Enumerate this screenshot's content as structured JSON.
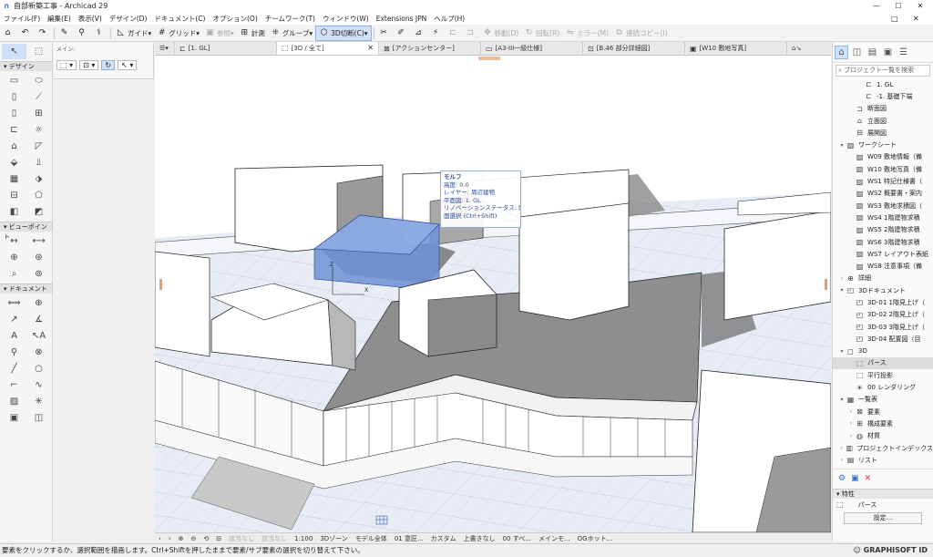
{
  "window": {
    "title": "自部新築工事 - Archicad 29",
    "logo_icon": "archicad-logo-icon"
  },
  "menu": [
    "ファイル(F)",
    "編集(E)",
    "表示(V)",
    "デザイン(D)",
    "ドキュメント(C)",
    "オプション(O)",
    "チームワーク(T)",
    "ウィンドウ(W)",
    "Extensions JPN",
    "ヘルプ(H)"
  ],
  "toolbar": {
    "guide": "ガイド",
    "grid": "グリッド",
    "reference": "参照",
    "measure": "計測",
    "group": "グループ",
    "section3d": "3D切断(C)",
    "move": "移動(D)",
    "rotate": "回転(R)",
    "mirror": "ミラー(M)",
    "multicopy": "連続コピー(I)"
  },
  "toolbox": {
    "design_header": "デザイン",
    "viewpoint_header": "ビューポイント",
    "document_header": "ドキュメント",
    "info_label": "メイン:"
  },
  "tabs": [
    {
      "label": "[1. GL]",
      "icon": "floorplan-icon"
    },
    {
      "label": "[3D / 全て]",
      "icon": "3d-icon",
      "active": true
    },
    {
      "label": "[アクションセンター]",
      "icon": "action-center-icon"
    },
    {
      "label": "[A3-III一級仕様]",
      "icon": "layout-icon"
    },
    {
      "label": "[B.46 部分詳細図]",
      "icon": "detail-icon"
    },
    {
      "label": "[W10 敷地写真]",
      "icon": "worksheet-icon"
    }
  ],
  "tooltip": {
    "title": "モルフ",
    "lines": [
      "高度: 0.0",
      "レイヤー: 周辺建物",
      "平面図: 1. GL",
      "リノベーションステータス: 既存",
      "面選択 (Ctrl+Shift)"
    ]
  },
  "viewport_status": {
    "undo_zoom": "該当なし",
    "redo_zoom": "該当なし",
    "scale": "1:100",
    "zone": "3Dゾーン",
    "model": "モデル全体",
    "renovation": "01 意匠...",
    "pen": "カスタム",
    "override": "上書きなし",
    "layer": "00 すべ...",
    "structure": "メインモ...",
    "og": "OGホット..."
  },
  "navigator": {
    "search_placeholder": "プロジェクト一覧を検索",
    "items": [
      {
        "label": "1. GL",
        "indent": 2,
        "arrow": "",
        "icon": "story-icon"
      },
      {
        "label": "-1. 基礎下端",
        "indent": 2,
        "arrow": "",
        "icon": "story-icon"
      },
      {
        "label": "断面図",
        "indent": 1,
        "arrow": "",
        "icon": "section-icon"
      },
      {
        "label": "立面図",
        "indent": 1,
        "arrow": "",
        "icon": "elevation-icon"
      },
      {
        "label": "展開図",
        "indent": 1,
        "arrow": "",
        "icon": "interior-elevation-icon"
      },
      {
        "label": "ワークシート",
        "indent": 0,
        "arrow": "▾",
        "icon": "worksheet-icon"
      },
      {
        "label": "W09 敷地情報（備",
        "indent": 1,
        "arrow": "",
        "icon": "worksheet-icon"
      },
      {
        "label": "W10 敷地写真（備",
        "indent": 1,
        "arrow": "",
        "icon": "worksheet-icon"
      },
      {
        "label": "WS1 特記仕様書（",
        "indent": 1,
        "arrow": "",
        "icon": "worksheet-icon"
      },
      {
        "label": "WS2 概要書・案内",
        "indent": 1,
        "arrow": "",
        "icon": "worksheet-icon"
      },
      {
        "label": "WS3 敷地求積図（",
        "indent": 1,
        "arrow": "",
        "icon": "worksheet-icon"
      },
      {
        "label": "WS4 1階建物求積",
        "indent": 1,
        "arrow": "",
        "icon": "worksheet-icon"
      },
      {
        "label": "WS5 2階建物求積",
        "indent": 1,
        "arrow": "",
        "icon": "worksheet-icon"
      },
      {
        "label": "WS6 3階建物求積",
        "indent": 1,
        "arrow": "",
        "icon": "worksheet-icon"
      },
      {
        "label": "WS7 レイアウト表紙",
        "indent": 1,
        "arrow": "",
        "icon": "worksheet-icon"
      },
      {
        "label": "WS8 注意事項（備",
        "indent": 1,
        "arrow": "",
        "icon": "worksheet-icon"
      },
      {
        "label": "詳細",
        "indent": 0,
        "arrow": "›",
        "icon": "detail-icon"
      },
      {
        "label": "3Dドキュメント",
        "indent": 0,
        "arrow": "▾",
        "icon": "3d-document-icon"
      },
      {
        "label": "3D-01 1階見上げ（",
        "indent": 1,
        "arrow": "",
        "icon": "3d-document-icon"
      },
      {
        "label": "3D-02 2階見上げ（",
        "indent": 1,
        "arrow": "",
        "icon": "3d-document-icon"
      },
      {
        "label": "3D-03 3階見上げ（",
        "indent": 1,
        "arrow": "",
        "icon": "3d-document-icon"
      },
      {
        "label": "3D-04 配置図（目",
        "indent": 1,
        "arrow": "",
        "icon": "3d-document-icon"
      },
      {
        "label": "3D",
        "indent": 0,
        "arrow": "▾",
        "icon": "3d-icon"
      },
      {
        "label": "パース",
        "indent": 1,
        "arrow": "",
        "icon": "perspective-icon",
        "selected": true
      },
      {
        "label": "平行投影",
        "indent": 1,
        "arrow": "",
        "icon": "axonometry-icon"
      },
      {
        "label": "00 レンダリング",
        "indent": 1,
        "arrow": "",
        "icon": "rendering-icon"
      },
      {
        "label": "一覧表",
        "indent": 0,
        "arrow": "▾",
        "icon": "schedule-icon"
      },
      {
        "label": "要素",
        "indent": 1,
        "arrow": "›",
        "icon": "element-icon"
      },
      {
        "label": "構成要素",
        "indent": 1,
        "arrow": "›",
        "icon": "component-icon"
      },
      {
        "label": "材質",
        "indent": 1,
        "arrow": "›",
        "icon": "surface-icon"
      },
      {
        "label": "プロジェクトインデックス",
        "indent": 0,
        "arrow": "›",
        "icon": "index-icon"
      },
      {
        "label": "リスト",
        "indent": 0,
        "arrow": "›",
        "icon": "list-icon"
      }
    ],
    "properties_header": "特性",
    "properties_value": "パース",
    "settings_button": "設定..."
  },
  "statusbar": {
    "message": "要素をクリックするか、選択範囲を描画します。Ctrl+Shiftを押したままで要素/サブ要素の選択を切り替えて下さい。",
    "brand": "GRAPHISOFT ID"
  },
  "colors": {
    "selection": "#6f92d6",
    "accent": "#2a6fd6"
  }
}
